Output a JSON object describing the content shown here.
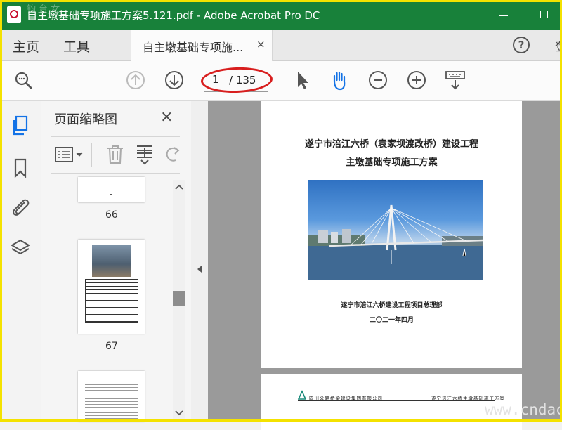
{
  "window": {
    "title": "自主墩基础专项施工方案5.121.pdf - Adobe Acrobat Pro DC",
    "watermark_corner": "钧 台 女"
  },
  "tabs": {
    "home": "主页",
    "tools": "工具",
    "document": "自主墩基础专项施...",
    "close": "×",
    "help": "?",
    "edge_char": "登"
  },
  "toolbar": {
    "current_page": "1",
    "total_pages": "/ 135",
    "icons": [
      "search-icon",
      "page-up-icon",
      "page-down-icon",
      "select-cursor-icon",
      "hand-tool-icon",
      "zoom-out-icon",
      "zoom-in-icon",
      "keyboard-scroll-icon"
    ]
  },
  "sidebar": {
    "icons": [
      "page-thumbnails-icon",
      "bookmarks-icon",
      "attachments-icon",
      "layers-icon"
    ]
  },
  "thumbnails_panel": {
    "title": "页面缩略图",
    "close": "×",
    "icons": [
      "options-menu-icon",
      "delete-icon",
      "insert-page-icon",
      "rotate-icon"
    ],
    "pages": [
      {
        "number": "66"
      },
      {
        "number": "67"
      }
    ]
  },
  "document": {
    "title_line1": "遂宁市涪江六桥（袁家坝渡改桥）建设工程",
    "title_line2": "主墩基础专项施工方案",
    "org": "遂宁市涪江六桥建设工程项目总理部",
    "date": "二〇二一年四月",
    "page2_header_left": "四川公路桥梁建设集团有限公司",
    "page2_header_right": "遂宁涪江六桥主墩基础施工方案"
  },
  "watermark": "www.cndac",
  "colors": {
    "titlebar": "#18813a",
    "accent_blue": "#1473e6",
    "highlight_ellipse": "#d81e1e",
    "frame": "#f4e200"
  }
}
